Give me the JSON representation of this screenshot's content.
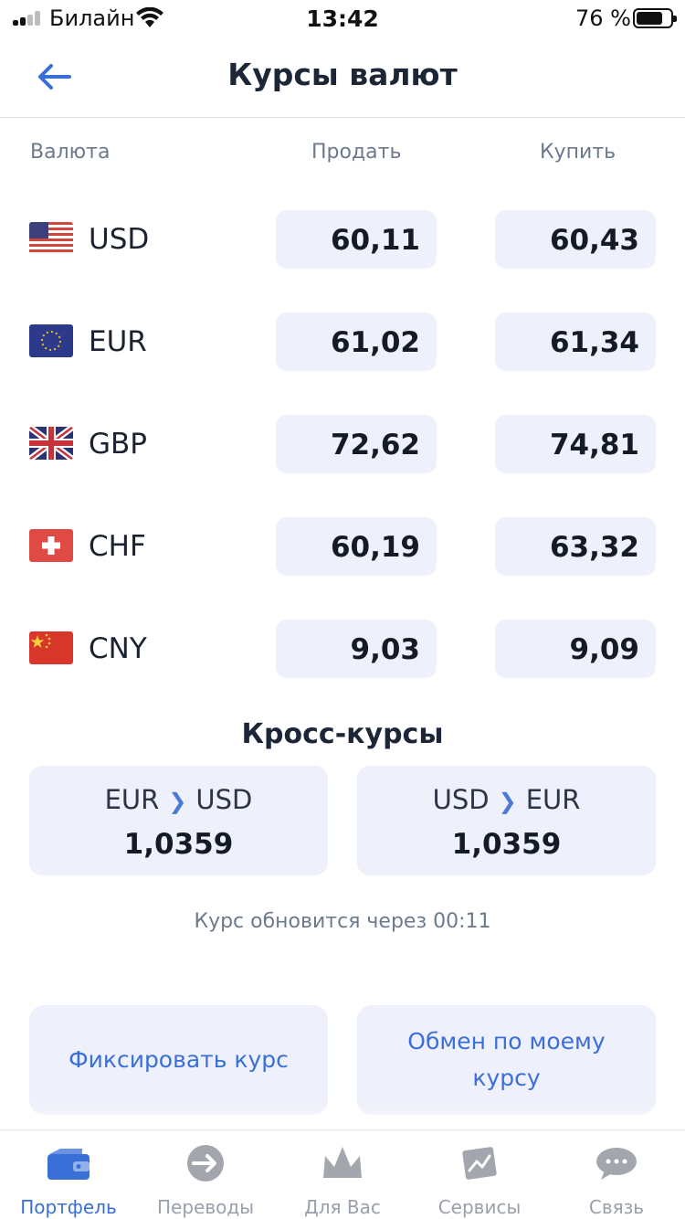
{
  "status_bar": {
    "carrier": "Билайн",
    "time": "13:42",
    "battery": "76 %",
    "battery_level": 0.76
  },
  "header": {
    "title": "Курсы валют",
    "back_icon": "arrow-left-icon"
  },
  "columns": {
    "currency": "Валюта",
    "sell": "Продать",
    "buy": "Купить"
  },
  "rates": [
    {
      "code": "USD",
      "flag": "us-flag-icon",
      "sell": "60,11",
      "buy": "60,43"
    },
    {
      "code": "EUR",
      "flag": "eu-flag-icon",
      "sell": "61,02",
      "buy": "61,34"
    },
    {
      "code": "GBP",
      "flag": "gb-flag-icon",
      "sell": "72,62",
      "buy": "74,81"
    },
    {
      "code": "CHF",
      "flag": "ch-flag-icon",
      "sell": "60,19",
      "buy": "63,32"
    },
    {
      "code": "CNY",
      "flag": "cn-flag-icon",
      "sell": "9,03",
      "buy": "9,09"
    }
  ],
  "cross_rates": {
    "title": "Кросс-курсы",
    "items": [
      {
        "from": "EUR",
        "to": "USD",
        "value": "1,0359"
      },
      {
        "from": "USD",
        "to": "EUR",
        "value": "1,0359"
      }
    ]
  },
  "update_text": "Курс обновится через 00:11",
  "actions": {
    "fix_rate": "Фиксировать курс",
    "my_rate": "Обмен по моему курсу"
  },
  "tabs": [
    {
      "label": "Портфель",
      "icon": "wallet-icon",
      "active": true
    },
    {
      "label": "Переводы",
      "icon": "transfer-arrow-icon",
      "active": false
    },
    {
      "label": "Для Вас",
      "icon": "crown-icon",
      "active": false
    },
    {
      "label": "Сервисы",
      "icon": "services-icon",
      "active": false
    },
    {
      "label": "Связь",
      "icon": "chat-bubbles-icon",
      "active": false
    }
  ],
  "colors": {
    "accent": "#3a6fd8",
    "card_bg": "#eef1fb",
    "muted_text": "#6d7a8e"
  }
}
